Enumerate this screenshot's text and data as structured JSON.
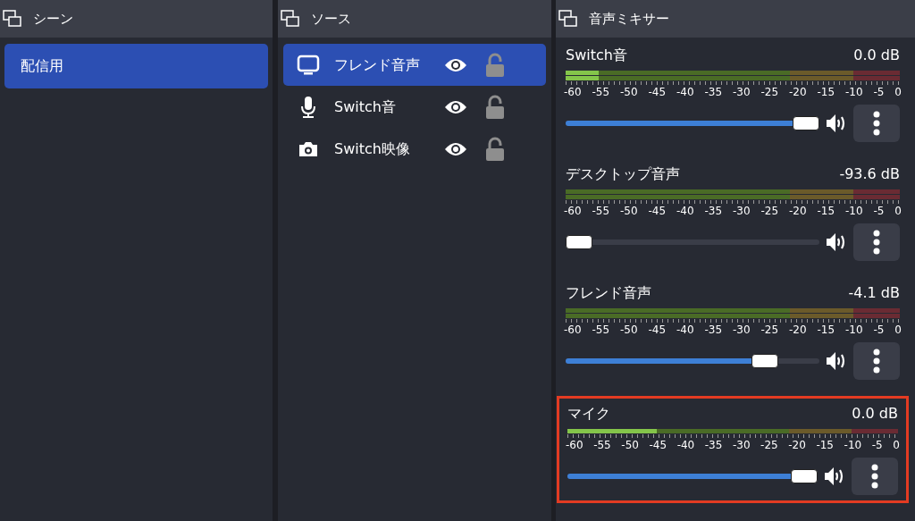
{
  "scenes": {
    "title": "シーン",
    "items": [
      {
        "label": "配信用",
        "selected": true
      }
    ]
  },
  "sources": {
    "title": "ソース",
    "items": [
      {
        "kind": "display",
        "label": "フレンド音声",
        "selected": true,
        "visible": true,
        "locked": false
      },
      {
        "kind": "audio",
        "label": "Switch音",
        "selected": false,
        "visible": true,
        "locked": false
      },
      {
        "kind": "camera",
        "label": "Switch映像",
        "selected": false,
        "visible": true,
        "locked": false
      }
    ]
  },
  "mixer": {
    "title": "音声ミキサー",
    "channels": [
      {
        "name": "Switch音",
        "reading": "0.0 dB",
        "meter": {
          "level": 0.1
        },
        "stereo": true,
        "scale": [
          "-60",
          "-55",
          "-50",
          "-45",
          "-40",
          "-35",
          "-30",
          "-25",
          "-20",
          "-15",
          "-10",
          "-5",
          "0"
        ],
        "level": 1,
        "highlighted": false
      },
      {
        "name": "デスクトップ音声",
        "reading": "-93.6 dB",
        "meter": {
          "level": 0
        },
        "stereo": true,
        "scale": [
          "-60",
          "-55",
          "-50",
          "-45",
          "-40",
          "-35",
          "-30",
          "-25",
          "-20",
          "-15",
          "-10",
          "-5",
          "0"
        ],
        "level": 0,
        "highlighted": false
      },
      {
        "name": "フレンド音声",
        "reading": "-4.1 dB",
        "meter": {
          "level": 0
        },
        "stereo": true,
        "scale": [
          "-60",
          "-55",
          "-50",
          "-45",
          "-40",
          "-35",
          "-30",
          "-25",
          "-20",
          "-15",
          "-10",
          "-5",
          "0"
        ],
        "level": 0.82,
        "highlighted": false
      },
      {
        "name": "マイク",
        "reading": "0.0 dB",
        "meter": {
          "level": 0.27
        },
        "stereo": false,
        "scale": [
          "-60",
          "-55",
          "-50",
          "-45",
          "-40",
          "-35",
          "-30",
          "-25",
          "-20",
          "-15",
          "-10",
          "-5",
          "0"
        ],
        "level": 1,
        "highlighted": true
      }
    ]
  }
}
